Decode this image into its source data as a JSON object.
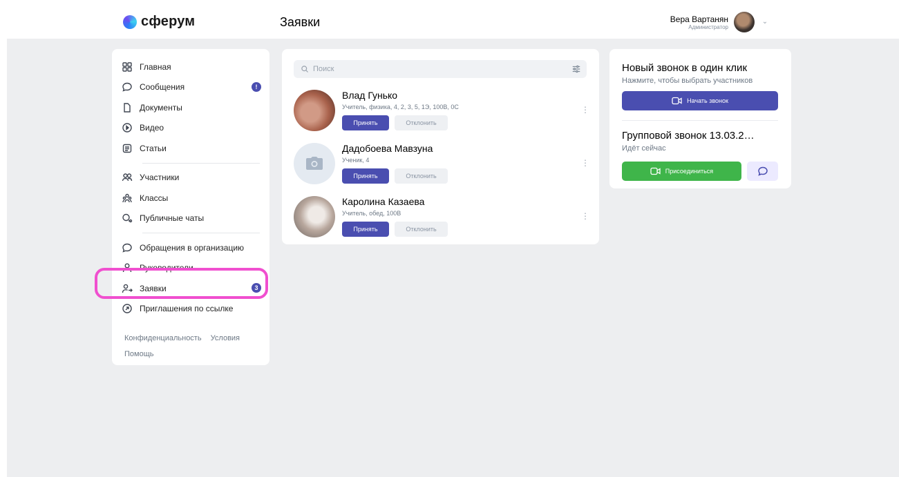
{
  "header": {
    "logo_text": "сферум",
    "page_title": "Заявки",
    "user_name": "Вера Вартанян",
    "user_role": "Администратор"
  },
  "nav": {
    "items": [
      {
        "label": "Главная",
        "icon": "grid-icon"
      },
      {
        "label": "Сообщения",
        "icon": "message-icon",
        "badge": "!"
      },
      {
        "label": "Документы",
        "icon": "document-icon"
      },
      {
        "label": "Видео",
        "icon": "video-play-icon"
      },
      {
        "label": "Статьи",
        "icon": "article-icon"
      },
      {
        "label": "Участники",
        "icon": "people-icon"
      },
      {
        "label": "Классы",
        "icon": "class-icon"
      },
      {
        "label": "Публичные чаты",
        "icon": "public-chat-icon"
      },
      {
        "label": "Обращения в организацию",
        "icon": "appeal-icon"
      },
      {
        "label": "Руководители",
        "icon": "person-icon"
      },
      {
        "label": "Заявки",
        "icon": "user-arrow-icon",
        "badge": "3"
      },
      {
        "label": "Приглашения по ссылке",
        "icon": "link-arrow-icon"
      }
    ],
    "footer": {
      "privacy": "Конфиденциальность",
      "terms": "Условия",
      "help": "Помощь"
    }
  },
  "search": {
    "placeholder": "Поиск"
  },
  "requests": [
    {
      "name": "Влад Гунько",
      "details": "Учитель, физика, 4, 2, 3, 5, 1Э, 100В, 0С",
      "accept": "Принять",
      "decline": "Отклонить"
    },
    {
      "name": "Дадобоева Мавзуна",
      "details": "Ученик, 4",
      "accept": "Принять",
      "decline": "Отклонить"
    },
    {
      "name": "Каролина Казаева",
      "details": "Учитель, обед, 100В",
      "accept": "Принять",
      "decline": "Отклонить"
    }
  ],
  "calls": {
    "new_title": "Новый звонок в один клик",
    "new_subtitle": "Нажмите, чтобы выбрать участников",
    "start_label": "Начать звонок",
    "group_title": "Групповой звонок 13.03.2…",
    "group_status": "Идёт сейчас",
    "join_label": "Присоединиться"
  },
  "colors": {
    "accent": "#4a4eb0",
    "join_green": "#3fb54a",
    "highlight": "#f04fcf",
    "background": "#edeef0"
  }
}
